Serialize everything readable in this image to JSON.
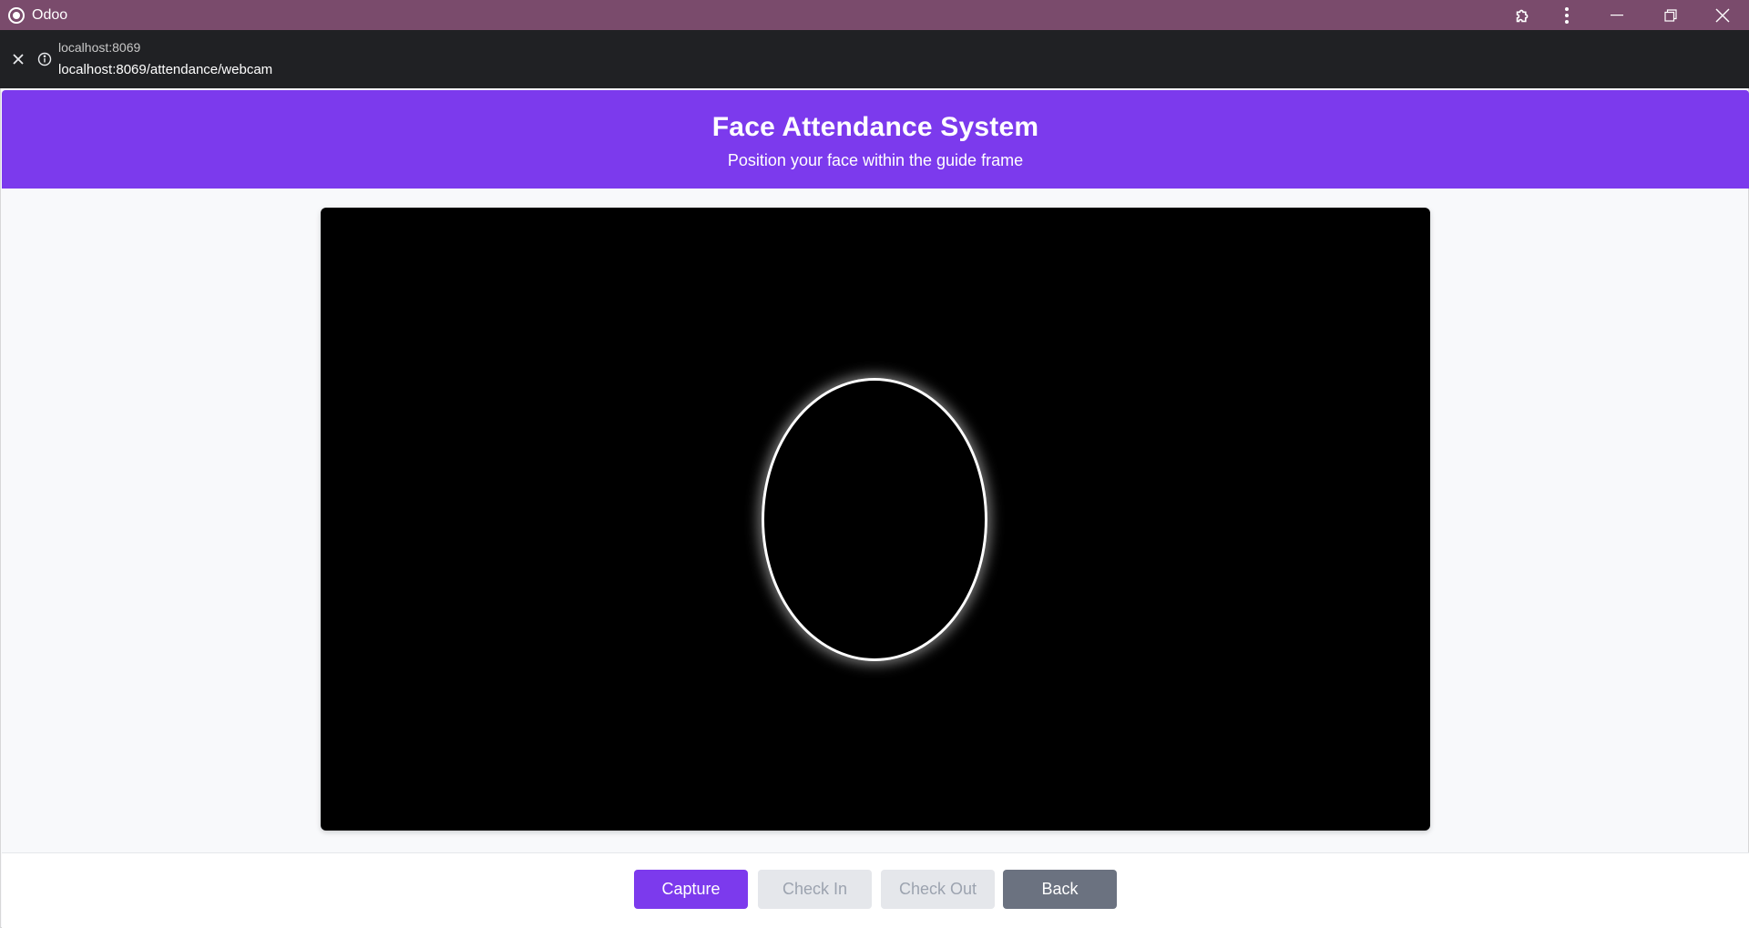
{
  "window": {
    "title": "Odoo",
    "icons": [
      "app-logo-icon",
      "extensions-icon",
      "more-vert-icon",
      "minimize-icon",
      "restore-icon",
      "close-icon"
    ]
  },
  "urlbar": {
    "host": "localhost:8069",
    "url": "localhost:8069/attendance/webcam"
  },
  "header": {
    "title": "Face Attendance System",
    "subtitle": "Position your face within the guide frame"
  },
  "buttons": {
    "capture": "Capture",
    "check_in": "Check In",
    "check_out": "Check Out",
    "back": "Back"
  },
  "colors": {
    "window_titlebar": "#7a4b6c",
    "accent": "#7c3aed",
    "disabled": "#e5e7eb",
    "back": "#6b7280"
  }
}
